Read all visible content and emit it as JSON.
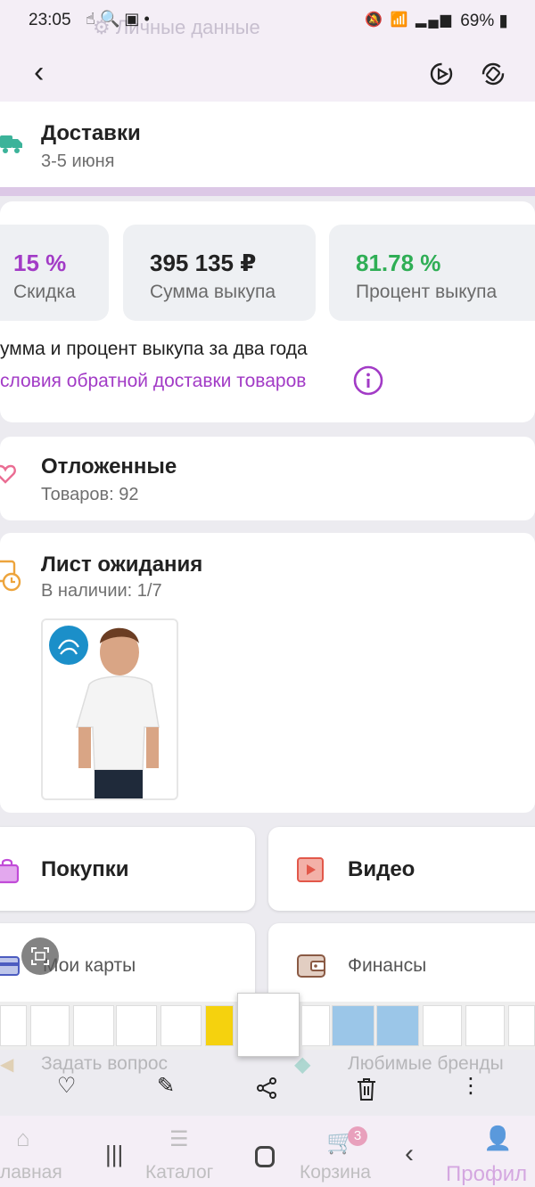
{
  "status": {
    "time": "23:05",
    "battery": "69%",
    "ghost_title": "Личные данные"
  },
  "delivery": {
    "title": "Доставки",
    "subtitle": "3-5 июня"
  },
  "stats": [
    {
      "value": "15 %",
      "label": "Скидка",
      "color": "#a23bc6"
    },
    {
      "value": "395 135 ₽",
      "label": "Сумма выкупа",
      "color": "#222222"
    },
    {
      "value": "81.78 %",
      "label": "Процент выкупа",
      "color": "#2fae55"
    }
  ],
  "stats_note": "умма и процент выкупа за два года",
  "return_link": "словия обратной доставки товаров",
  "favorites": {
    "title": "Отложенные",
    "subtitle": "Товаров: 92"
  },
  "waitlist": {
    "title": "Лист ожидания",
    "subtitle": "В наличии: 1/7"
  },
  "tiles": {
    "purchases": "Покупки",
    "video": "Видео",
    "cards": "Мои карты",
    "finance": "Финансы",
    "ask": "Задать вопрос",
    "brands": "Любимые бренды"
  },
  "nav": {
    "home": "лавная",
    "catalog": "Каталог",
    "cart": "Корзина",
    "cart_badge": "3",
    "profile": "Профил"
  },
  "colors": {
    "accent": "#a23bc6",
    "green": "#2fae55"
  }
}
